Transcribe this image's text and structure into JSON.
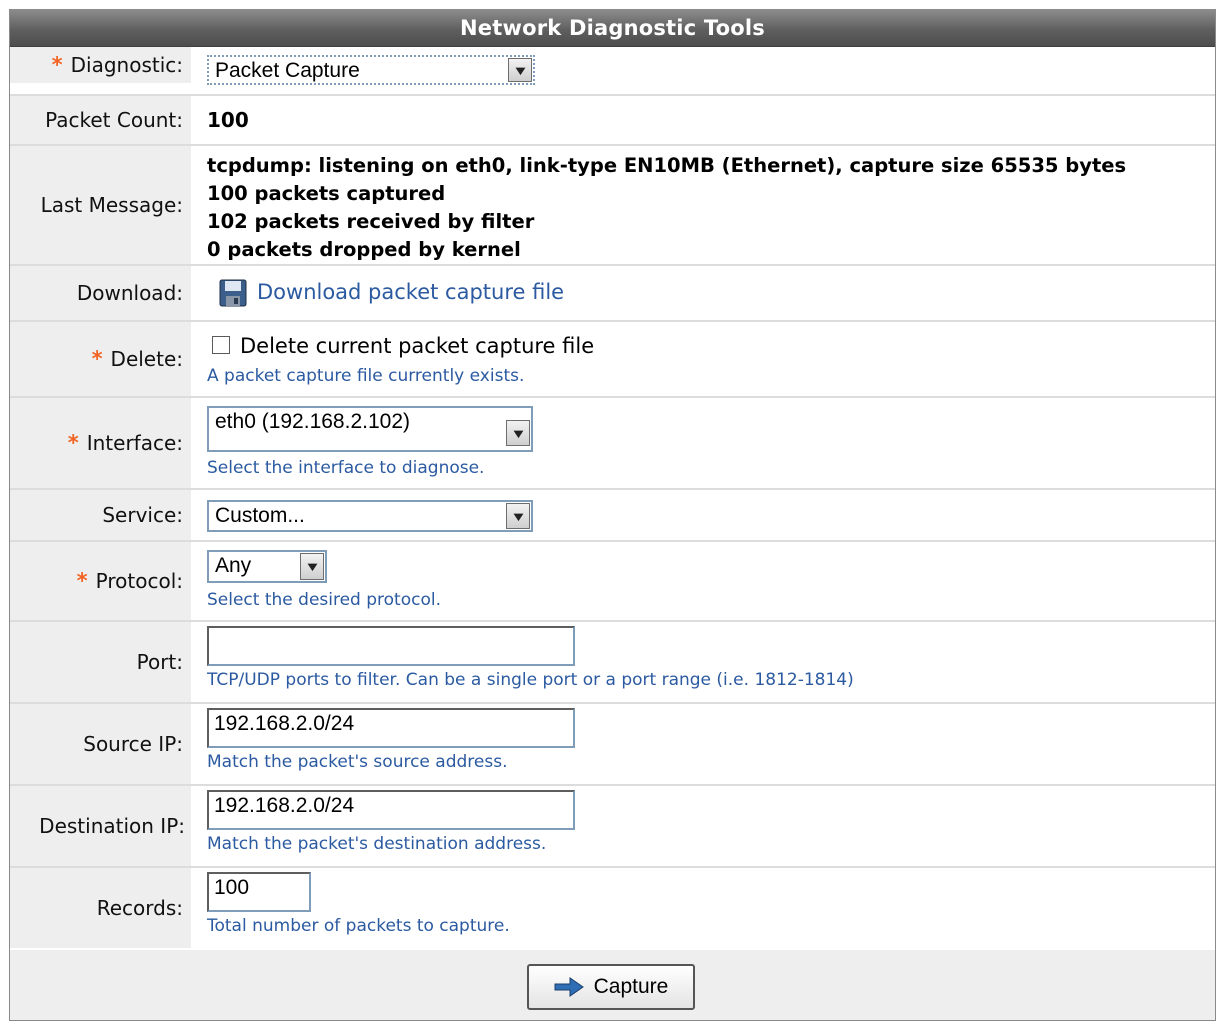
{
  "title": "Network Diagnostic Tools",
  "required_mark": "*",
  "labels": {
    "diagnostic": "Diagnostic:",
    "packet_count": "Packet Count:",
    "last_message": "Last Message:",
    "download": "Download:",
    "delete": "Delete:",
    "interface": "Interface:",
    "service": "Service:",
    "protocol": "Protocol:",
    "port": "Port:",
    "source_ip": "Source IP:",
    "destination_ip": "Destination IP:",
    "records": "Records:"
  },
  "values": {
    "diagnostic": "Packet Capture",
    "packet_count": "100",
    "last_message": [
      "tcpdump: listening on eth0, link-type EN10MB (Ethernet), capture size 65535 bytes",
      "100 packets captured",
      "102 packets received by filter",
      "0 packets dropped by kernel"
    ],
    "download_link": "Download packet capture file",
    "delete_checkbox_label": "Delete current packet capture file",
    "delete_checked": false,
    "interface": "eth0 (192.168.2.102)",
    "service": "Custom...",
    "protocol": "Any",
    "port": "",
    "source_ip": "192.168.2.0/24",
    "destination_ip": "192.168.2.0/24",
    "records": "100"
  },
  "hints": {
    "delete": "A packet capture file currently exists.",
    "interface": "Select the interface to diagnose.",
    "protocol": "Select the desired protocol.",
    "port": "TCP/UDP ports to filter. Can be a single port or a port range (i.e. 1812-1814)",
    "source_ip": "Match the packet's source address.",
    "destination_ip": "Match the packet's destination address.",
    "records": "Total number of packets to capture."
  },
  "buttons": {
    "capture": "Capture"
  },
  "icons": {
    "download": "floppy-disk-icon",
    "capture": "arrow-right-icon",
    "dropdown": "chevron-down-icon"
  },
  "colors": {
    "required": "#f26322",
    "hint": "#2b5aa1",
    "link": "#2b5aa1",
    "title_bar": "#5f5f5f"
  }
}
